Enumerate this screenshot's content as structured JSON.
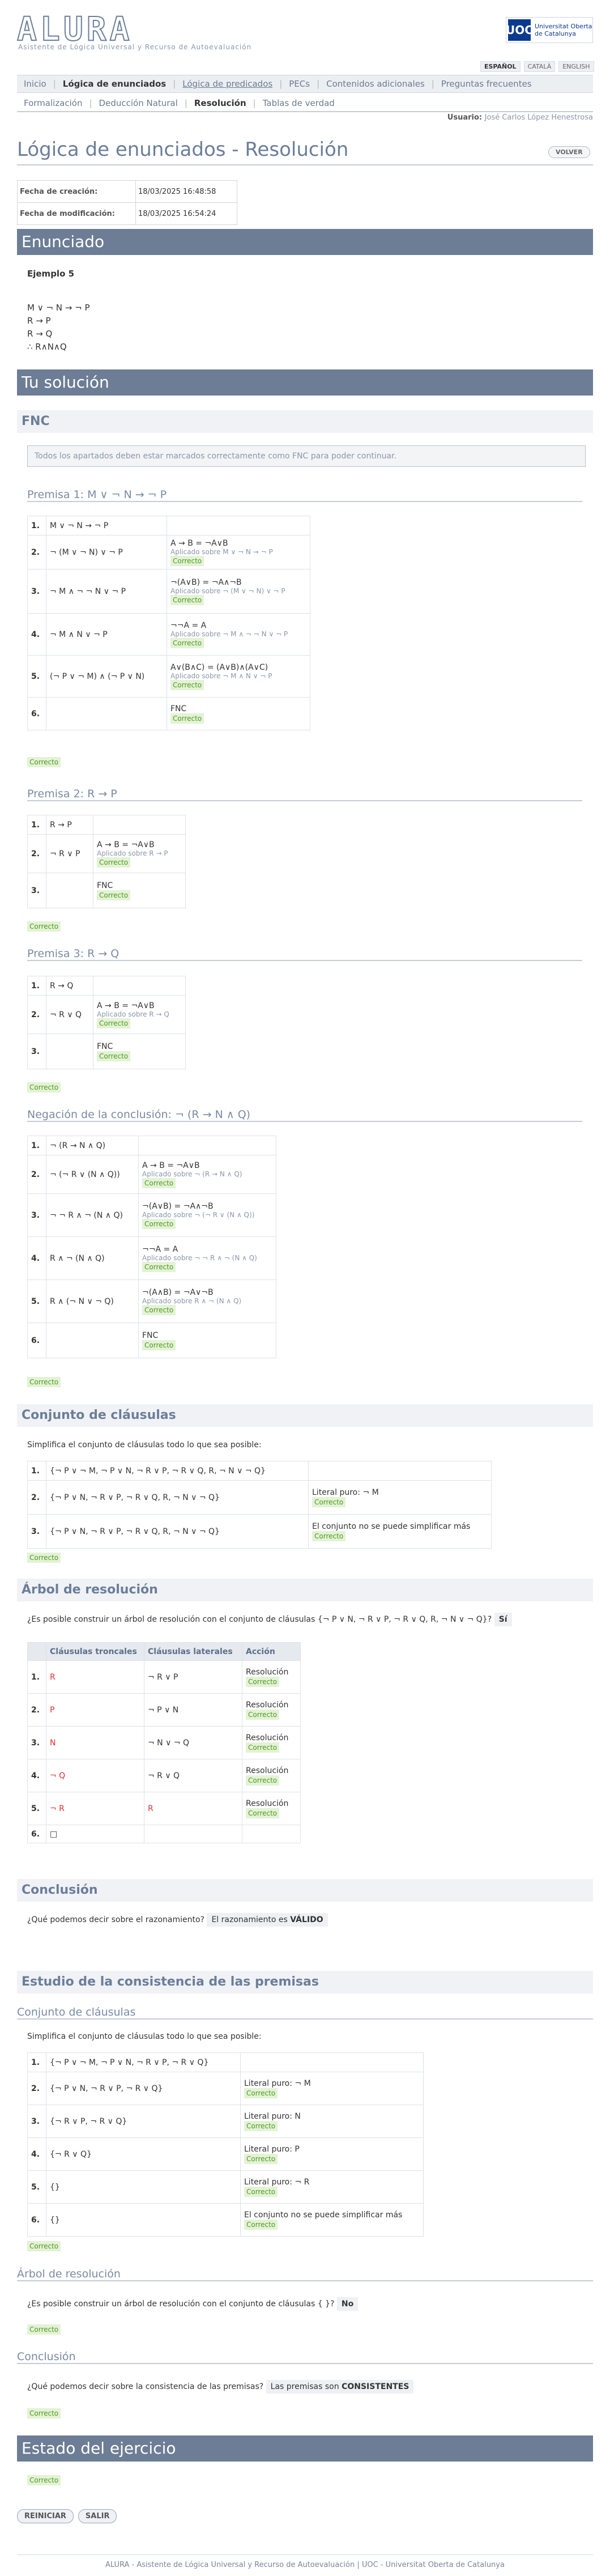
{
  "brand": {
    "logo": "ALURA",
    "subtitle": "Asistente de Lógica Universal y Recurso de Autoevaluación",
    "uoc_mark": "UOC",
    "uoc_text1": "Universitat Oberta",
    "uoc_text2": "de Catalunya"
  },
  "languages": [
    {
      "label": "ESPAÑOL",
      "active": true
    },
    {
      "label": "CATALÀ",
      "active": false
    },
    {
      "label": "ENGLISH",
      "active": false
    }
  ],
  "nav": {
    "items": [
      "Inicio",
      "Lógica de enunciados",
      "Lógica de predicados",
      "PECs",
      "Contenidos adicionales",
      "Preguntas frecuentes"
    ]
  },
  "subnav": {
    "items": [
      "Formalización",
      "Deducción Natural",
      "Resolución",
      "Tablas de verdad"
    ]
  },
  "user": {
    "label": "Usuario:",
    "name": "José Carlos López Henestrosa"
  },
  "page": {
    "title": "Lógica de enunciados - Resolución",
    "back": "VOLVER"
  },
  "meta": {
    "created_label": "Fecha de creación:",
    "created": "18/03/2025 16:48:58",
    "modified_label": "Fecha de modificación:",
    "modified": "18/03/2025 16:54:24"
  },
  "enunciado": {
    "title": "Enunciado",
    "example": "Ejemplo 5",
    "lines": [
      "M ∨ ¬ N → ¬ P",
      "R → P",
      "R → Q",
      "∴ R∧N∧Q"
    ]
  },
  "solution": {
    "title": "Tu solución",
    "fnc_title": "FNC",
    "info": "Todos los apartados deben estar marcados correctamente como FNC para poder continuar.",
    "correct": "Correcto"
  },
  "premisa1": {
    "title": "Premisa 1: M ∨ ¬ N → ¬ P",
    "rows": [
      {
        "n": "1.",
        "f": "M ∨ ¬ N → ¬ P",
        "rule": "",
        "applied": ""
      },
      {
        "n": "2.",
        "f": "¬ (M ∨ ¬ N) ∨ ¬ P",
        "rule": "A → B = ¬A∨B",
        "applied": "Aplicado sobre M ∨ ¬ N → ¬ P"
      },
      {
        "n": "3.",
        "f": "¬ M ∧ ¬ ¬ N ∨ ¬ P",
        "rule": "¬(A∨B) = ¬A∧¬B",
        "applied": "Aplicado sobre ¬ (M ∨ ¬ N) ∨ ¬ P"
      },
      {
        "n": "4.",
        "f": "¬ M ∧ N ∨ ¬ P",
        "rule": "¬¬A = A",
        "applied": "Aplicado sobre ¬ M ∧ ¬ ¬ N ∨ ¬ P"
      },
      {
        "n": "5.",
        "f": "(¬ P ∨ ¬ M) ∧ (¬ P ∨ N)",
        "rule": "A∨(B∧C) = (A∨B)∧(A∨C)",
        "applied": "Aplicado sobre ¬ M ∧ N ∨ ¬ P"
      },
      {
        "n": "6.",
        "f": "",
        "rule": "FNC",
        "applied": ""
      }
    ]
  },
  "premisa2": {
    "title": "Premisa 2: R → P",
    "rows": [
      {
        "n": "1.",
        "f": "R → P",
        "rule": "",
        "applied": ""
      },
      {
        "n": "2.",
        "f": "¬ R ∨ P",
        "rule": "A → B = ¬A∨B",
        "applied": "Aplicado sobre R → P"
      },
      {
        "n": "3.",
        "f": "",
        "rule": "FNC",
        "applied": ""
      }
    ]
  },
  "premisa3": {
    "title": "Premisa 3: R → Q",
    "rows": [
      {
        "n": "1.",
        "f": "R → Q",
        "rule": "",
        "applied": ""
      },
      {
        "n": "2.",
        "f": "¬ R ∨ Q",
        "rule": "A → B = ¬A∨B",
        "applied": "Aplicado sobre R → Q"
      },
      {
        "n": "3.",
        "f": "",
        "rule": "FNC",
        "applied": ""
      }
    ]
  },
  "negacion": {
    "title": "Negación de la conclusión: ¬ (R → N ∧ Q)",
    "rows": [
      {
        "n": "1.",
        "f": "¬ (R → N ∧ Q)",
        "rule": "",
        "applied": ""
      },
      {
        "n": "2.",
        "f": "¬ (¬ R ∨ (N ∧ Q))",
        "rule": "A → B = ¬A∨B",
        "applied": "Aplicado sobre ¬ (R → N ∧ Q)"
      },
      {
        "n": "3.",
        "f": "¬ ¬ R ∧ ¬ (N ∧ Q)",
        "rule": "¬(A∨B) = ¬A∧¬B",
        "applied": "Aplicado sobre ¬ (¬ R ∨ (N ∧ Q))"
      },
      {
        "n": "4.",
        "f": "R ∧ ¬ (N ∧ Q)",
        "rule": "¬¬A = A",
        "applied": "Aplicado sobre ¬ ¬ R ∧ ¬ (N ∧ Q)"
      },
      {
        "n": "5.",
        "f": "R ∧ (¬ N ∨ ¬ Q)",
        "rule": "¬(A∧B) = ¬A∨¬B",
        "applied": "Aplicado sobre R ∧ ¬ (N ∧ Q)"
      },
      {
        "n": "6.",
        "f": "",
        "rule": "FNC",
        "applied": ""
      }
    ]
  },
  "clausulas": {
    "title": "Conjunto de cláusulas",
    "prompt": "Simplifica el conjunto de cláusulas todo lo que sea posible:",
    "rows": [
      {
        "n": "1.",
        "f": "{¬ P ∨ ¬ M, ¬ P ∨ N, ¬ R ∨ P, ¬ R ∨ Q, R, ¬ N ∨ ¬ Q}",
        "r": ""
      },
      {
        "n": "2.",
        "f": "{¬ P ∨ N, ¬ R ∨ P, ¬ R ∨ Q, R, ¬ N ∨ ¬ Q}",
        "r": "Literal puro: ¬ M"
      },
      {
        "n": "3.",
        "f": "{¬ P ∨ N, ¬ R ∨ P, ¬ R ∨ Q, R, ¬ N ∨ ¬ Q}",
        "r": "El conjunto no se puede simplificar más"
      }
    ]
  },
  "arbol": {
    "title": "Árbol de resolución",
    "question": "¿Es posible construir un árbol de resolución con el conjunto de cláusulas {¬ P ∨ N, ¬ R ∨ P, ¬ R ∨ Q, R, ¬ N ∨ ¬ Q}?",
    "answer": "Sí",
    "headers": [
      "Cláusulas troncales",
      "Cláusulas laterales",
      "Acción"
    ],
    "rows": [
      {
        "n": "1.",
        "t": "R",
        "l": "¬ R ∨ P",
        "a": "Resolución"
      },
      {
        "n": "2.",
        "t": "P",
        "l": "¬ P ∨ N",
        "a": "Resolución"
      },
      {
        "n": "3.",
        "t": "N",
        "l": "¬ N ∨ ¬ Q",
        "a": "Resolución"
      },
      {
        "n": "4.",
        "t": "¬ Q",
        "l": "¬ R ∨ Q",
        "a": "Resolución"
      },
      {
        "n": "5.",
        "t": "¬ R",
        "l": "R",
        "a": "Resolución"
      },
      {
        "n": "6.",
        "t": "□",
        "l": "",
        "a": ""
      }
    ]
  },
  "conclusion": {
    "title": "Conclusión",
    "question": "¿Qué podemos decir sobre el razonamiento?",
    "answer_pre": "El razonamiento es",
    "answer_b": "VÁLIDO"
  },
  "consistencia": {
    "title": "Estudio de la consistencia de las premisas",
    "sub1": "Conjunto de cláusulas",
    "prompt": "Simplifica el conjunto de cláusulas todo lo que sea posible:",
    "rows": [
      {
        "n": "1.",
        "f": "{¬ P ∨ ¬ M, ¬ P ∨ N, ¬ R ∨ P, ¬ R ∨ Q}",
        "r": ""
      },
      {
        "n": "2.",
        "f": "{¬ P ∨ N, ¬ R ∨ P, ¬ R ∨ Q}",
        "r": "Literal puro: ¬ M"
      },
      {
        "n": "3.",
        "f": "{¬ R ∨ P, ¬ R ∨ Q}",
        "r": "Literal puro: N"
      },
      {
        "n": "4.",
        "f": "{¬ R ∨ Q}",
        "r": "Literal puro: P"
      },
      {
        "n": "5.",
        "f": "{}",
        "r": "Literal puro: ¬ R"
      },
      {
        "n": "6.",
        "f": "{}",
        "r": "El conjunto no se puede simplificar más"
      }
    ],
    "sub2": "Árbol de resolución",
    "question2": "¿Es posible construir un árbol de resolución con el conjunto de cláusulas { }?",
    "answer2": "No",
    "sub3": "Conclusión",
    "question3": "¿Qué podemos decir sobre la consistencia de las premisas?",
    "answer3_pre": "Las premisas son",
    "answer3_b": "CONSISTENTES"
  },
  "estado": {
    "title": "Estado del ejercicio"
  },
  "buttons": {
    "reiniciar": "REINICIAR",
    "salir": "SALIR"
  },
  "footer": "ALURA - Asistente de Lógica Universal y Recurso de Autoevaluación | UOC - Universitat Oberta de Catalunya"
}
